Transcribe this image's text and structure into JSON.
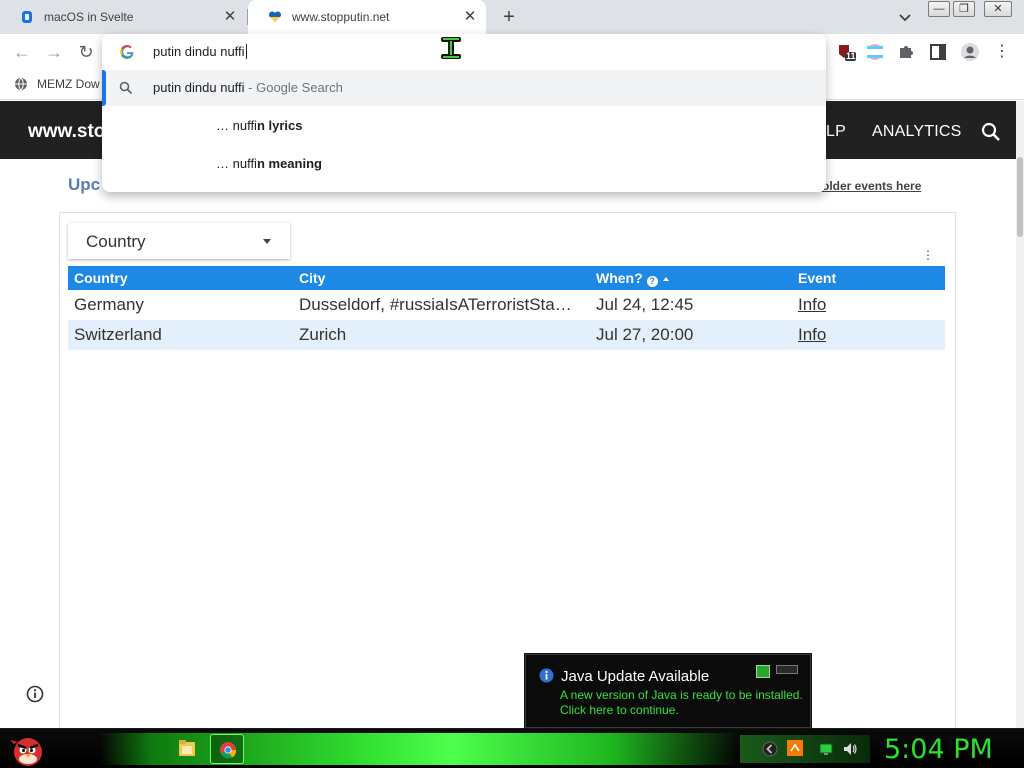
{
  "browser": {
    "tabs": [
      {
        "title": "macOS in Svelte",
        "active": false
      },
      {
        "title": "www.stopputin.net",
        "active": true
      }
    ],
    "new_tab_label": "+",
    "bookmark": {
      "label": "MEMZ Dow"
    },
    "extension_badge": "11"
  },
  "omnibox": {
    "typed": "putin dindu nuffi",
    "suggestions": [
      {
        "text": "putin dindu nuffi",
        "suffix": " - Google Search",
        "icon": "search-icon"
      },
      {
        "prefix": "… nuffi",
        "bold": "n lyrics"
      },
      {
        "prefix": "… nuffi",
        "bold": "n meaning"
      }
    ]
  },
  "site": {
    "title": "www.sto",
    "nav": [
      "LP",
      "ANALYTICS"
    ],
    "heading": "Upc",
    "older_link": "older events here"
  },
  "filter": {
    "label": "Country"
  },
  "table": {
    "headers": [
      "Country",
      "City",
      "When?",
      "Event"
    ],
    "help_glyph": "?",
    "rows": [
      {
        "country": "Germany",
        "city": "Dusseldorf, #russiaIsATerroristSta…",
        "when": "Jul 24, 12:45",
        "event": "Info"
      },
      {
        "country": "Switzerland",
        "city": "Zurich",
        "when": "Jul 27, 20:00",
        "event": "Info"
      }
    ]
  },
  "java_popup": {
    "title": "Java Update Available",
    "message_line1": "A new version of Java is ready to be installed.",
    "message_line2": "Click here to continue."
  },
  "taskbar": {
    "clock": "5:04 PM"
  },
  "colors": {
    "table_header": "#1e88e5",
    "row_alt": "#e3f0fc",
    "site_bar": "#212121",
    "java_text": "#39e03b",
    "clock": "#2ee02e"
  }
}
